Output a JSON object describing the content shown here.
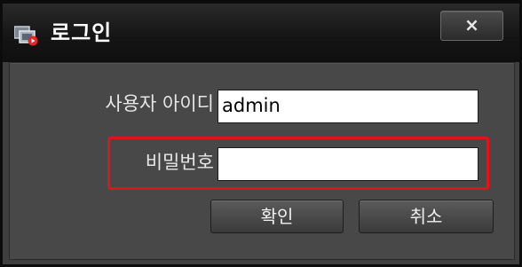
{
  "window": {
    "title": "로그인",
    "close_label": "×"
  },
  "form": {
    "userid_label": "사용자 아이디",
    "userid_value": "admin",
    "password_label": "비밀번호",
    "password_value": ""
  },
  "buttons": {
    "ok_label": "확인",
    "cancel_label": "취소"
  },
  "colors": {
    "highlight": "#e0141b",
    "background": "#484848",
    "titlebar": "#141414"
  },
  "icons": {
    "app": "monitor-record-icon",
    "close": "close-icon"
  }
}
